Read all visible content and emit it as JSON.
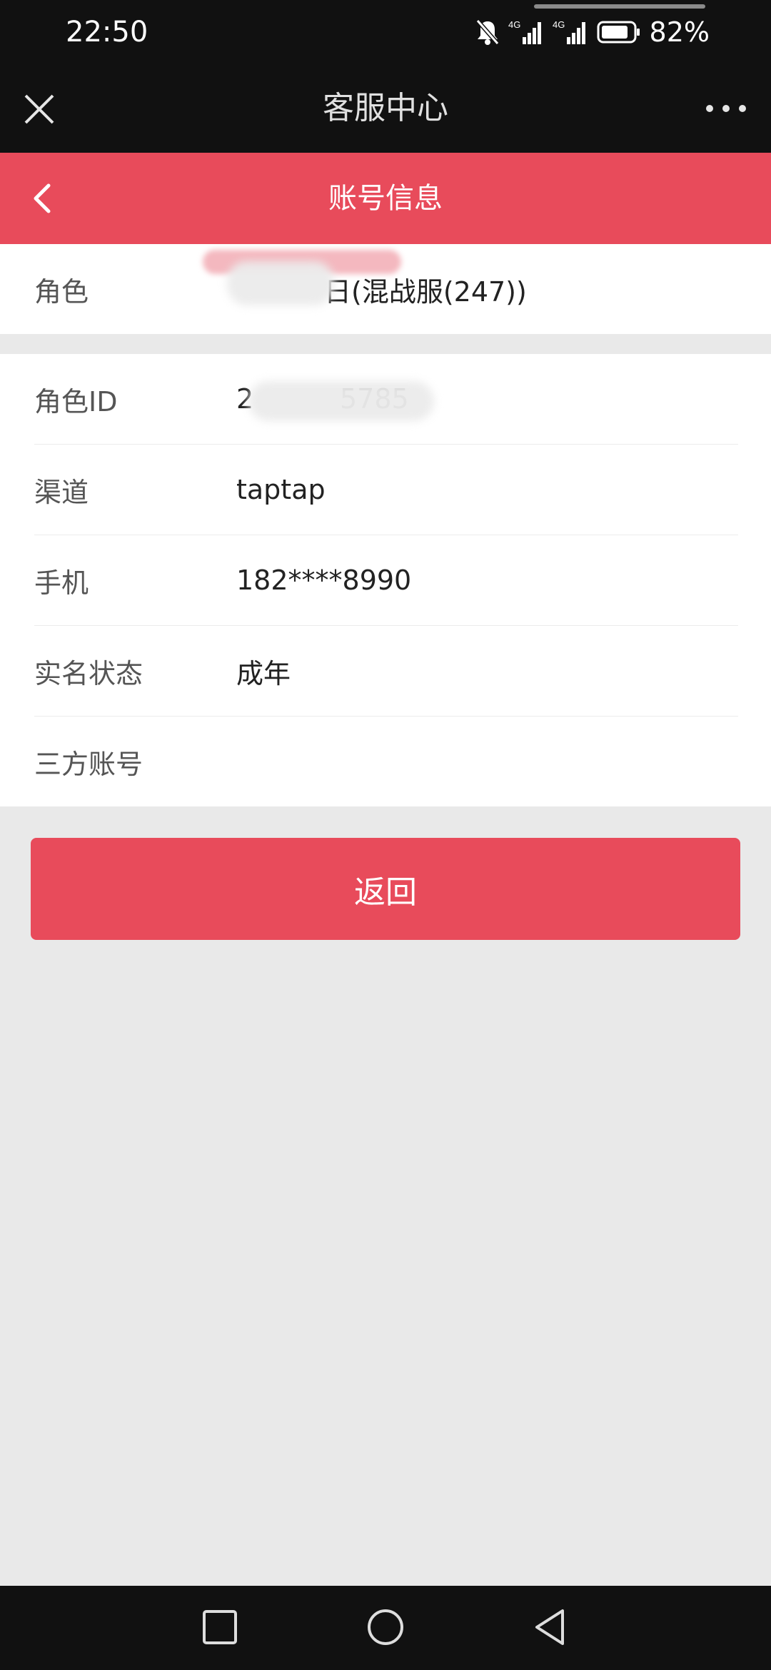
{
  "status_bar": {
    "time": "22:50",
    "battery_percent": "82%",
    "icons": [
      "mute-bell-icon",
      "signal-4g-icon",
      "signal-4g-icon",
      "battery-icon"
    ]
  },
  "wechat_header": {
    "title": "客服中心",
    "close_icon": "close-icon",
    "more_icon": "more-dots-icon"
  },
  "page_header": {
    "title": "账号信息",
    "back_icon": "chevron-left-icon"
  },
  "role": {
    "label": "角色",
    "value": "日(混战服(247))"
  },
  "details": [
    {
      "label": "角色ID",
      "value": "2          5785"
    },
    {
      "label": "渠道",
      "value": "taptap"
    },
    {
      "label": "手机",
      "value": "182****8990"
    },
    {
      "label": "实名状态",
      "value": "成年"
    },
    {
      "label": "三方账号",
      "value": ""
    }
  ],
  "return_button": {
    "label": "返回"
  },
  "nav_bar": {
    "icons": [
      "square-recents-icon",
      "circle-home-icon",
      "triangle-back-icon"
    ]
  },
  "colors": {
    "accent": "#e84b5b",
    "header_dark": "#111111",
    "background": "#e9e9e9"
  }
}
